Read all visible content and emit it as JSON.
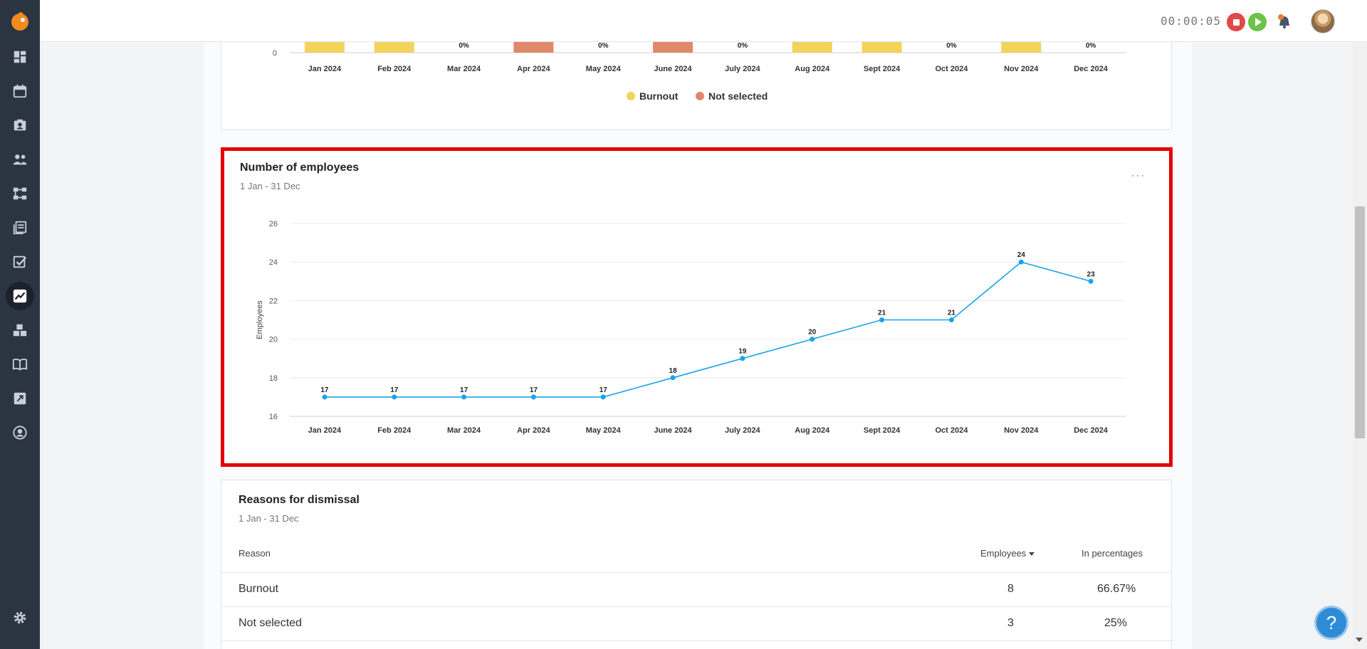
{
  "topbar": {
    "timer": "00:00:05"
  },
  "sidebar": {
    "items": [
      {
        "icon": "dashboard-icon"
      },
      {
        "icon": "calendar-icon"
      },
      {
        "icon": "contacts-icon"
      },
      {
        "icon": "people-icon"
      },
      {
        "icon": "workflow-icon"
      },
      {
        "icon": "documents-icon"
      },
      {
        "icon": "tasks-icon"
      },
      {
        "icon": "analytics-icon",
        "active": true
      },
      {
        "icon": "boxes-icon"
      },
      {
        "icon": "book-icon"
      },
      {
        "icon": "export-icon"
      },
      {
        "icon": "profile-icon"
      },
      {
        "icon": "gear-icon"
      }
    ]
  },
  "top_chart": {
    "months": [
      "Jan 2024",
      "Feb 2024",
      "Mar 2024",
      "Apr 2024",
      "May 2024",
      "June 2024",
      "July 2024",
      "Aug 2024",
      "Sept 2024",
      "Oct 2024",
      "Nov 2024",
      "Dec 2024"
    ],
    "bar_series": [
      "burnout",
      "burnout",
      "none",
      "not_selected",
      "none",
      "not_selected",
      "none",
      "burnout",
      "burnout",
      "none",
      "burnout",
      "none"
    ],
    "zero_labels": [
      "",
      "",
      "0%",
      "",
      "0%",
      "",
      "0%",
      "",
      "",
      "0%",
      "",
      "0%"
    ],
    "y_zero": "0",
    "legend": [
      {
        "label": "Burnout",
        "color": "#f2d35b"
      },
      {
        "label": "Not selected",
        "color": "#e0886a"
      }
    ]
  },
  "employees_card": {
    "title": "Number of employees",
    "subtitle": "1 Jan - 31 Dec",
    "more": "···"
  },
  "chart_data": {
    "type": "line",
    "title": "Number of employees",
    "subtitle": "1 Jan - 31 Dec",
    "xlabel": "",
    "ylabel": "Employees",
    "categories": [
      "Jan 2024",
      "Feb 2024",
      "Mar 2024",
      "Apr 2024",
      "May 2024",
      "June 2024",
      "July 2024",
      "Aug 2024",
      "Sept 2024",
      "Oct 2024",
      "Nov 2024",
      "Dec 2024"
    ],
    "series": [
      {
        "values": [
          17,
          17,
          17,
          17,
          17,
          18,
          19,
          20,
          21,
          21,
          24,
          23
        ],
        "color": "#1aa3e8"
      }
    ],
    "ylim": [
      16,
      26
    ],
    "yticks": [
      16,
      18,
      20,
      22,
      24,
      26
    ],
    "grid": true,
    "data_labels": true
  },
  "reasons": {
    "title": "Reasons for dismissal",
    "subtitle": "1 Jan - 31 Dec",
    "columns": {
      "reason": "Reason",
      "employees": "Employees",
      "percent": "In percentages"
    },
    "rows": [
      {
        "reason": "Burnout",
        "employees": "8",
        "percent": "66.67%"
      },
      {
        "reason": "Not selected",
        "employees": "3",
        "percent": "25%"
      }
    ]
  },
  "help": {
    "label": "?"
  }
}
